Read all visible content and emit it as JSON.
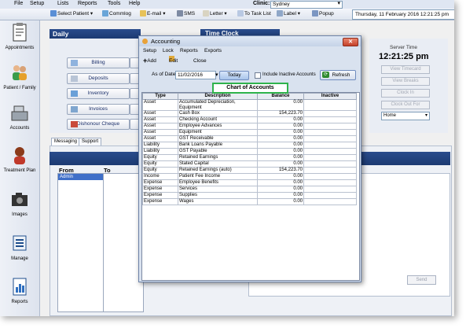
{
  "menubar": {
    "items": [
      "File",
      "Setup",
      "Lists",
      "Reports",
      "Tools",
      "Help"
    ],
    "clinic_label": "Clinic:",
    "clinic_value": "Sydney"
  },
  "toolbar": {
    "select_patient": "Select Patient",
    "commlog": "Commlog",
    "email": "E-mail",
    "sms": "SMS",
    "letter": "Letter",
    "to_task_list": "To Task List",
    "label": "Label",
    "popup": "Popup",
    "datetime": "Thursday, 11 February 2016 12:21:25 pm"
  },
  "nav": {
    "appointments": "Appointments",
    "patient_family": "Patient / Family",
    "accounts": "Accounts",
    "treatment_plan": "Treatment Plan",
    "images": "Images",
    "manage": "Manage",
    "reports": "Reports"
  },
  "daily": {
    "title": "Daily",
    "buttons": [
      "Billing",
      "Deposits",
      "Inventory",
      "Invoices",
      "Dishonour Cheque"
    ]
  },
  "timeclock": {
    "title": "Time Clock",
    "server_time_label": "Server Time",
    "server_time": "12:21:25 pm",
    "buttons": [
      "View Timecard",
      "View Breaks",
      "Clock In",
      "Clock Out For"
    ],
    "home_value": "Home"
  },
  "messaging": {
    "tabs": [
      "Messaging",
      "Support"
    ],
    "from_label": "From",
    "to_label": "To",
    "from_selected": "Admin",
    "send_label": "Send"
  },
  "dialog": {
    "title": "Accounting",
    "menu": [
      "Setup",
      "Lock",
      "Reports",
      "Exports"
    ],
    "tools": {
      "add": "Add",
      "edit": "Edit",
      "close": "Close"
    },
    "as_of_label": "As of Date",
    "as_of_value": "11/02/2016",
    "today_label": "Today",
    "include_inactive_label": "Include Inactive Accounts",
    "refresh_label": "Refresh",
    "grid_title": "Chart of Accounts",
    "columns": [
      "Type",
      "Description",
      "Balance",
      "Inactive"
    ],
    "rows": [
      [
        "Asset",
        "Accumulated Depreciation, Equipment",
        "0.00",
        ""
      ],
      [
        "Asset",
        "Cash Box",
        "154,223.70",
        ""
      ],
      [
        "Asset",
        "Checking Account",
        "0.00",
        ""
      ],
      [
        "Asset",
        "Employee Advances",
        "0.00",
        ""
      ],
      [
        "Asset",
        "Equipment",
        "0.00",
        ""
      ],
      [
        "Asset",
        "GST Receivable",
        "0.00",
        ""
      ],
      [
        "Liability",
        "Bank Loans Payable",
        "0.00",
        ""
      ],
      [
        "Liability",
        "GST Payable",
        "0.00",
        ""
      ],
      [
        "Equity",
        "Retained Earnings",
        "0.00",
        ""
      ],
      [
        "Equity",
        "Stated Capital",
        "0.00",
        ""
      ],
      [
        "Equity",
        "Retained Earnings (auto)",
        "154,223.70",
        ""
      ],
      [
        "Income",
        "Patient Fee Income",
        "0.00",
        ""
      ],
      [
        "Expense",
        "Employee Benefits",
        "0.00",
        ""
      ],
      [
        "Expense",
        "Services",
        "0.00",
        ""
      ],
      [
        "Expense",
        "Supplies",
        "0.00",
        ""
      ],
      [
        "Expense",
        "Wages",
        "0.00",
        ""
      ]
    ]
  },
  "colors": {
    "header_blue": "#1c3a72",
    "highlight_green": "#2fb34c",
    "selection_blue": "#3f6fc8"
  }
}
